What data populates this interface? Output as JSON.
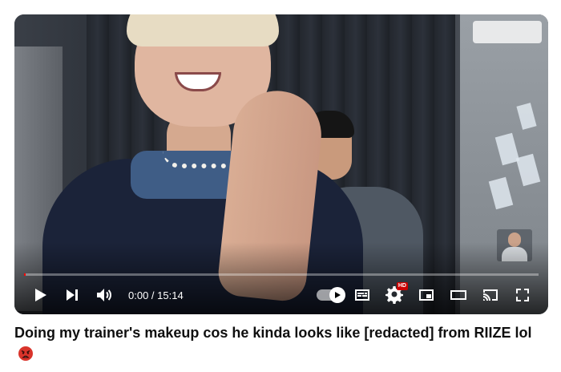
{
  "player": {
    "time_current": "0:00",
    "time_separator": " / ",
    "time_total": "15:14",
    "progress_fraction": 0.003,
    "accent_color": "#ff0000",
    "hd_badge": "HD"
  },
  "controls": {
    "icons": [
      "play-icon",
      "next-icon",
      "volume-icon",
      "autoplay-toggle",
      "subtitles-icon",
      "settings-icon",
      "miniplayer-icon",
      "theater-icon",
      "cast-icon",
      "fullscreen-icon"
    ]
  },
  "video": {
    "title": "Doing my trainer's makeup cos he kinda looks like [redacted] from RIIZE lol",
    "title_emoji": "angry-face-emoji"
  }
}
